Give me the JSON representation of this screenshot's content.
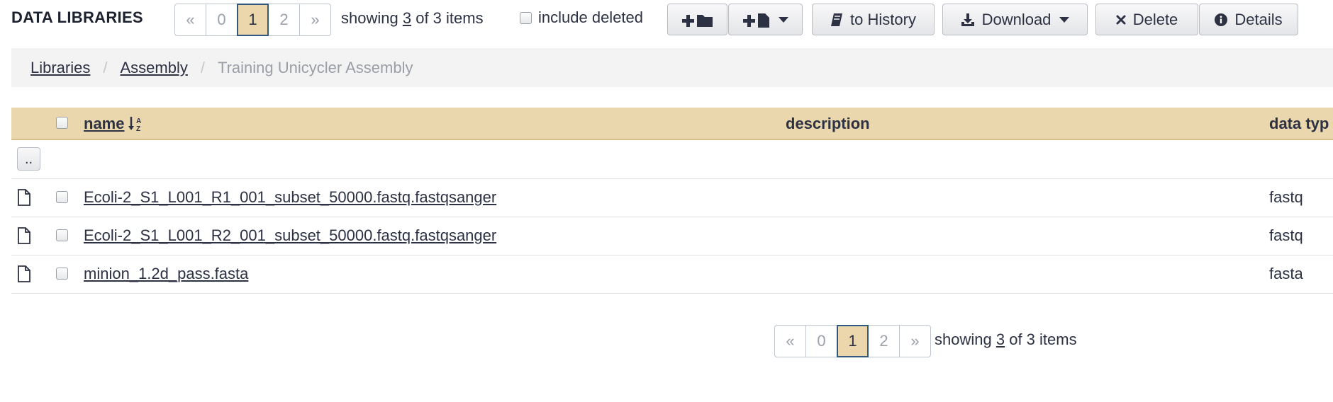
{
  "page": {
    "title": "DATA LIBRARIES"
  },
  "pager": {
    "first": "«",
    "pages": [
      "0",
      "1",
      "2"
    ],
    "active_page": "1",
    "last": "»",
    "info_prefix": "showing",
    "info_count": "3",
    "info_suffix": "of 3 items"
  },
  "toolbar": {
    "include_deleted_label": "include deleted",
    "to_history_label": "to History",
    "download_label": "Download",
    "delete_label": "Delete",
    "details_label": "Details",
    "icons": {
      "add_folder": "plus-folder-icon",
      "add_dataset": "plus-file-icon",
      "to_history": "book-icon",
      "download": "download-icon",
      "delete": "times-icon",
      "details": "info-circle-icon"
    }
  },
  "breadcrumb": {
    "items": [
      "Libraries",
      "Assembly"
    ],
    "current": "Training Unicycler Assembly"
  },
  "table": {
    "columns": {
      "name": "name",
      "description": "description",
      "data_type": "data typ"
    },
    "up_label": "..",
    "rows": [
      {
        "name": "Ecoli-2_S1_L001_R1_001_subset_50000.fastq.fastqsanger",
        "description": "",
        "data_type": "fastq"
      },
      {
        "name": "Ecoli-2_S1_L001_R2_001_subset_50000.fastq.fastqsanger",
        "description": "",
        "data_type": "fastq"
      },
      {
        "name": "minion_1.2d_pass.fasta",
        "description": "",
        "data_type": "fasta"
      }
    ]
  },
  "colors": {
    "header_bg": "#ebd7ad",
    "active_page_border": "#315783",
    "breadcrumb_bg": "#f3f3f3"
  }
}
